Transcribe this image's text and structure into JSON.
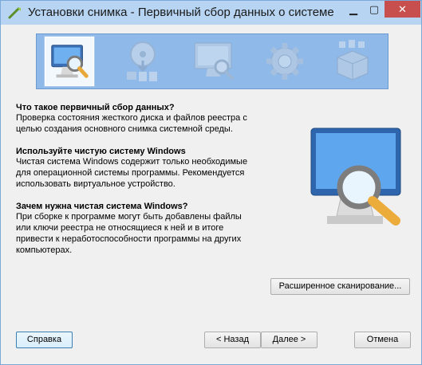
{
  "window": {
    "title": "Установки снимка - Первичный сбор данных о системе",
    "minimize_glyph": "▁",
    "maximize_glyph": "▢",
    "close_glyph": "✕"
  },
  "steps": [
    {
      "icon": "monitor-magnifier-icon",
      "active": true
    },
    {
      "icon": "disc-files-icon",
      "active": false
    },
    {
      "icon": "monitor-scan-icon",
      "active": false
    },
    {
      "icon": "gear-icon",
      "active": false
    },
    {
      "icon": "package-box-icon",
      "active": false
    }
  ],
  "sections": [
    {
      "heading": "Что такое первичный сбор данных?",
      "body": "Проверка состояния жесткого диска и файлов реестра с\nцелью создания основного снимка системной среды."
    },
    {
      "heading": "Используйте чистую систему Windows",
      "body": "Чистая система Windows содержит только необходимые\nдля операционной системы программы. Рекомендуется\nиспользовать виртуальное устройство."
    },
    {
      "heading": "Зачем нужна чистая система Windows?",
      "body": "При сборке к программе могут быть добавлены файлы\nили ключи реестра не относящиеся к ней и в итоге\nпривести к неработоспособности программы на других\nкомпьютерах."
    }
  ],
  "buttons": {
    "advanced_scan": "Расширенное сканирование...",
    "help": "Справка",
    "back": "< Назад",
    "next": "Далее >",
    "cancel": "Отмена"
  },
  "colors": {
    "titlebar": "#b7d5f2",
    "banner": "#8fb9e8",
    "close": "#c7504e"
  }
}
